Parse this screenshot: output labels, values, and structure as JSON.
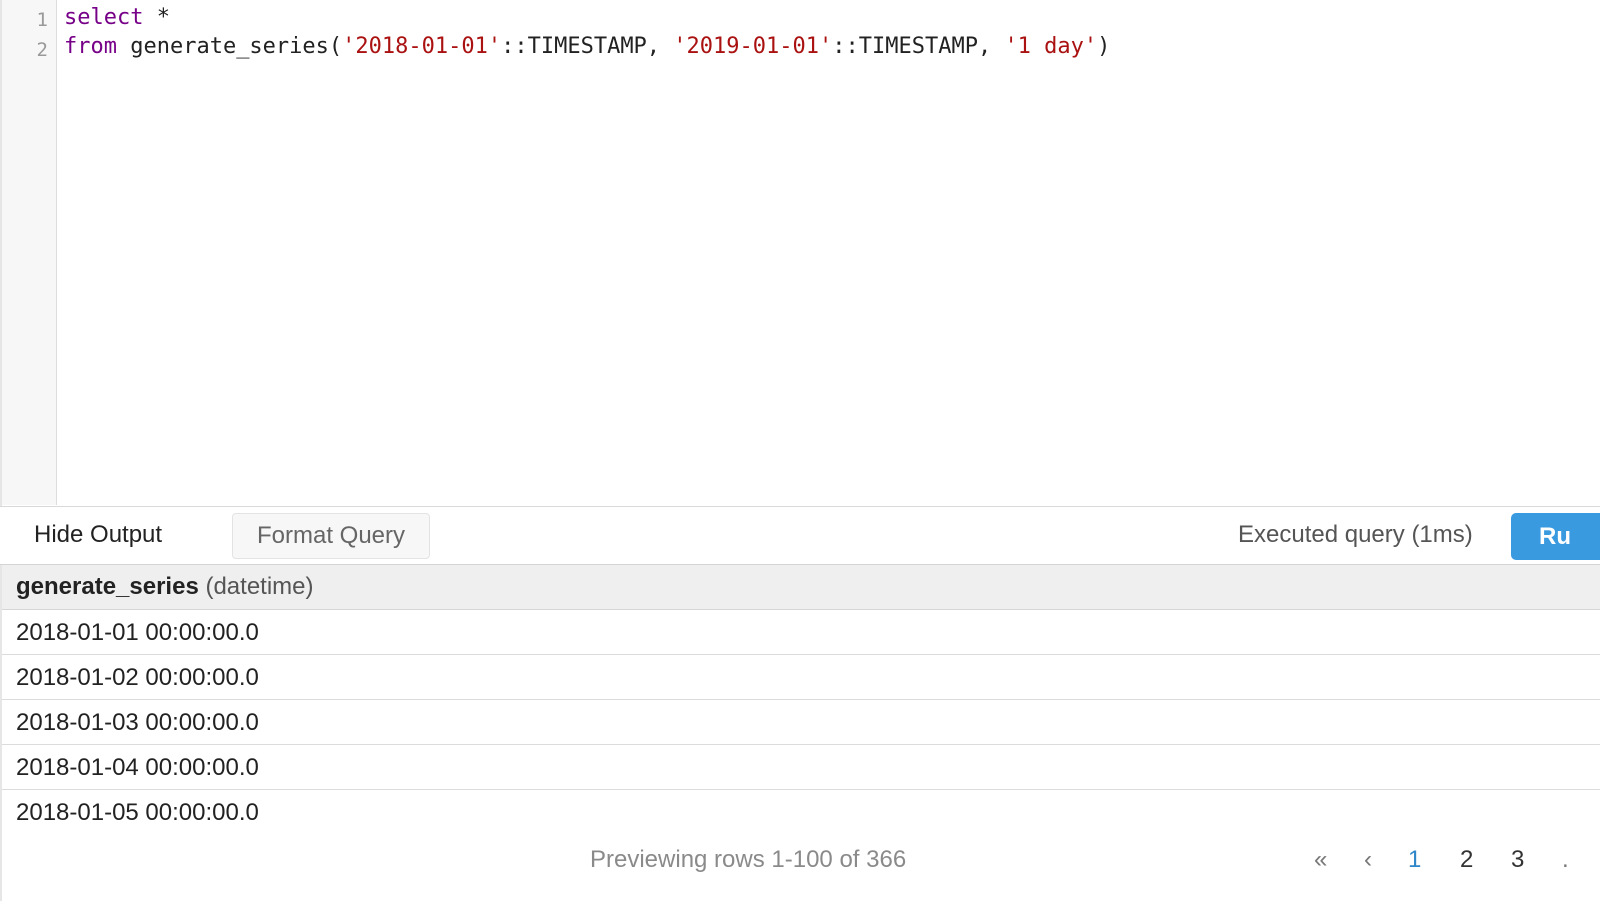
{
  "editor": {
    "line_numbers": [
      "1",
      "2"
    ],
    "line1": {
      "keyword": "select",
      "rest": " *"
    },
    "line2": {
      "keyword": "from",
      "func": " generate_series(",
      "str1": "'2018-01-01'",
      "cast1": "::TIMESTAMP, ",
      "str2": "'2019-01-01'",
      "cast2": "::TIMESTAMP, ",
      "str3": "'1 day'",
      "close": ")"
    }
  },
  "toolbar": {
    "hide_output_label": "Hide Output",
    "format_query_label": "Format Query",
    "status_text": "Executed query (1ms)",
    "run_label": "Ru"
  },
  "results": {
    "column": {
      "name": "generate_series",
      "type": "(datetime)"
    },
    "rows": [
      "2018-01-01 00:00:00.0",
      "2018-01-02 00:00:00.0",
      "2018-01-03 00:00:00.0",
      "2018-01-04 00:00:00.0",
      "2018-01-05 00:00:00.0"
    ]
  },
  "footer": {
    "preview_text": "Previewing rows 1-100 of 366",
    "pagination": {
      "first": "«",
      "prev": "‹",
      "pages": [
        "1",
        "2",
        "3"
      ],
      "current": "1",
      "more": "."
    }
  },
  "colors": {
    "keyword": "#770088",
    "string": "#aa1111",
    "run_button": "#3a9ae0",
    "active_page": "#2f86c8"
  }
}
